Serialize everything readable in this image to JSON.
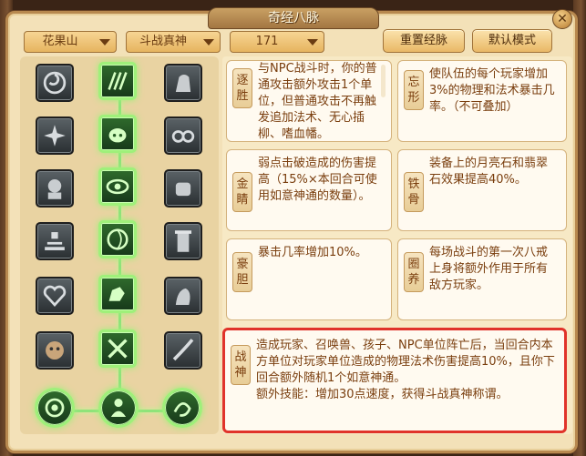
{
  "window": {
    "title": "奇经八脉",
    "close_label": "✕"
  },
  "toolbar": {
    "school_dropdown": "花果山",
    "technique_dropdown": "斗战真神",
    "level_dropdown": "171",
    "reset_button": "重置经脉",
    "default_button": "默认模式"
  },
  "grid": {
    "rows": [
      {
        "left": "node-icon",
        "center": "node-icon",
        "right": "node-icon"
      },
      {
        "left": "node-icon",
        "center": "node-icon",
        "right": "node-icon"
      },
      {
        "left": "node-icon",
        "center": "node-icon",
        "right": "node-icon"
      },
      {
        "left": "node-icon",
        "center": "node-icon",
        "right": "node-icon"
      },
      {
        "left": "node-icon",
        "center": "node-icon",
        "right": "node-icon"
      },
      {
        "left": "node-icon",
        "center": "node-icon",
        "right": "node-icon"
      },
      {
        "left": "node-icon",
        "center": "node-icon",
        "right": "node-icon"
      }
    ],
    "lit_color": "#9ff07a"
  },
  "cards": [
    {
      "name": "逐胜",
      "text": "与NPC战斗时，你的普通攻击额外攻击1个单位，但普通攻击不再触发追加法术、无心插柳、嗜血幡。"
    },
    {
      "name": "忘形",
      "text": "使队伍的每个玩家增加3%的物理和法术暴击几率。（不可叠加）"
    },
    {
      "name": "金睛",
      "text": "弱点击破造成的伤害提高（15%×本回合可使用如意神通的数量）。"
    },
    {
      "name": "铁骨",
      "text": "装备上的月亮石和翡翠石效果提高40%。"
    },
    {
      "name": "豪胆",
      "text": "暴击几率增加10%。"
    },
    {
      "name": "圈养",
      "text": "每场战斗的第一次八戒上身将额外作用于所有敌方玩家。"
    },
    {
      "name": "战神",
      "text": "造成玩家、召唤兽、孩子、NPC单位阵亡后，当回合内本方单位对玩家单位造成的物理法术伤害提高10%，且你下回合额外随机1个如意神通。",
      "extra": "额外技能：增加30点速度，获得斗战真神称谓。"
    }
  ],
  "colors": {
    "selected_border": "#e0332a",
    "text": "#7a3e0e",
    "panel": "#f3e1b8"
  }
}
